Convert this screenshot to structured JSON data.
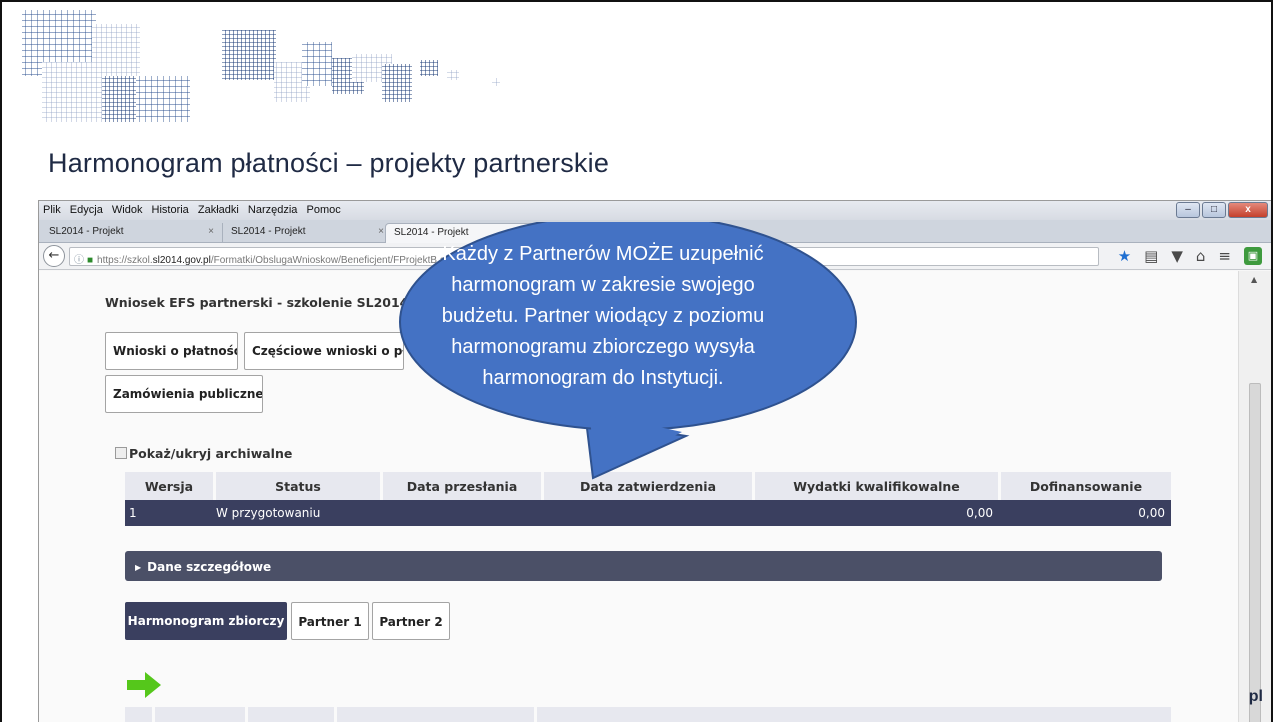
{
  "slide": {
    "title": "Harmonogram płatności – projekty partnerskie",
    "logo_fragment": "pl"
  },
  "browser": {
    "menu": [
      "Plik",
      "Edycja",
      "Widok",
      "Historia",
      "Zakładki",
      "Narzędzia",
      "Pomoc"
    ],
    "window_controls": {
      "minimize": "–",
      "maximize": "□",
      "close": "x"
    },
    "tabs": [
      {
        "label": "SL2014 - Projekt",
        "close": "×"
      },
      {
        "label": "SL2014 - Projekt",
        "close": "×"
      },
      {
        "label": "SL2014 - Projekt"
      }
    ],
    "url": {
      "prefix": "https://szkol.",
      "domain": "sl2014.gov.pl",
      "path": "/Formatki/ObslugaWnioskow/Beneficjent/FProjektB.as"
    }
  },
  "page": {
    "header": "Wniosek EFS partnerski - szkolenie SL2014 dla b",
    "buttons": {
      "wnioski": "Wnioski o płatność",
      "czesciowe": "Częściowe wnioski o pła",
      "zamowienia": "Zamówienia publiczne"
    },
    "archive_toggle": "Pokaż/ukryj archiwalne",
    "table": {
      "columns": [
        "Wersja",
        "Status",
        "Data przesłania",
        "Data zatwierdzenia",
        "Wydatki kwalifikowalne",
        "Dofinansowanie"
      ],
      "rows": [
        {
          "wersja": "1",
          "status": "W przygotowaniu",
          "data_przeslania": "",
          "data_zatwierdzenia": "",
          "wydatki": "0,00",
          "dofinansowanie": "0,00"
        }
      ]
    },
    "details_label": "Dane szczegółowe",
    "sub_tabs": {
      "zbiorczy": "Harmonogram zbiorczy",
      "partner1": "Partner 1",
      "partner2": "Partner 2"
    },
    "bottom_header_partial": "Dofinansowanie"
  },
  "callout": {
    "lines": [
      "Każdy z Partnerów MOŻE uzupełnić",
      "harmonogram w zakresie swojego",
      "budżetu. Partner wiodący z poziomu",
      "harmonogramu zbiorczego wysyła",
      "harmonogram do Instytucji."
    ]
  },
  "colors": {
    "slide_title": "#1f2a44",
    "pattern_blue": "#2b4f8f",
    "callout_fill": "#4472c4",
    "callout_border": "#2f528f",
    "table_row": "#3a3f5f",
    "accordion": "#4b5067",
    "arrow_green": "#55c71b"
  },
  "icons": {
    "back": "arrow-left-icon",
    "bookmark": "star-icon",
    "reader": "reader-icon",
    "pocket": "pocket-icon",
    "home": "home-icon",
    "menu": "hamburger-icon",
    "next": "green-arrow-icon"
  }
}
